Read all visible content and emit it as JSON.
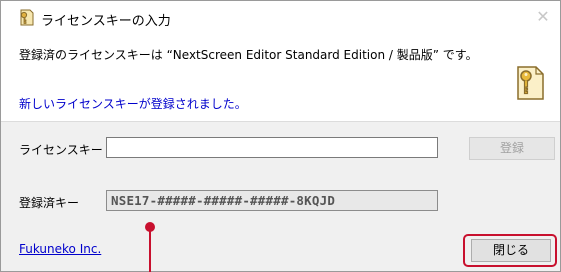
{
  "window": {
    "title": "ライセンスキーの入力",
    "close_glyph": "✕",
    "title_icon": "key-icon"
  },
  "info": {
    "line1": "登録済のライセンスキーは “NextScreen Editor Standard Edition / 製品版” です。",
    "line2": "新しいライセンスキーが登録されました。",
    "big_icon": "key-icon"
  },
  "form": {
    "license_key_label": "ライセンスキー",
    "license_key_value": "",
    "register_button": "登録",
    "registered_key_label": "登録済キー",
    "registered_key_value": "NSE17-#####-#####-#####-8KQJD"
  },
  "footer": {
    "company_link": "Fukuneko Inc.",
    "close_button": "閉じる"
  },
  "colors": {
    "highlight": "#c8102e",
    "link": "#0000cc"
  }
}
